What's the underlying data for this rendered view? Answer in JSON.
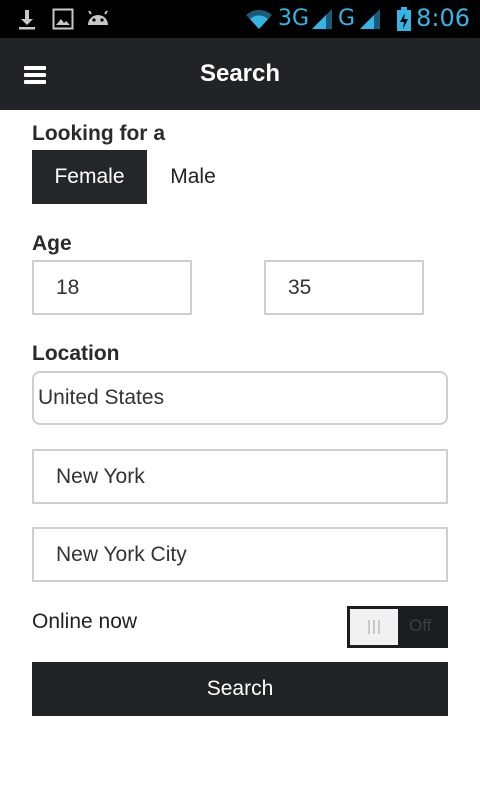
{
  "status_bar": {
    "network_3g": "3G",
    "network_g": "G",
    "time": "8:06"
  },
  "header": {
    "title": "Search"
  },
  "gender": {
    "label": "Looking for a",
    "options": [
      "Female",
      "Male"
    ],
    "selected": "Female"
  },
  "age": {
    "label": "Age",
    "min": "18",
    "max": "35"
  },
  "location": {
    "label": "Location",
    "country": "United States",
    "state": "New York",
    "city": "New York City"
  },
  "online": {
    "label": "Online now",
    "toggle_text": "Off"
  },
  "search_button": "Search",
  "colors": {
    "status_blue": "#33b5e5",
    "dark": "#222326"
  }
}
